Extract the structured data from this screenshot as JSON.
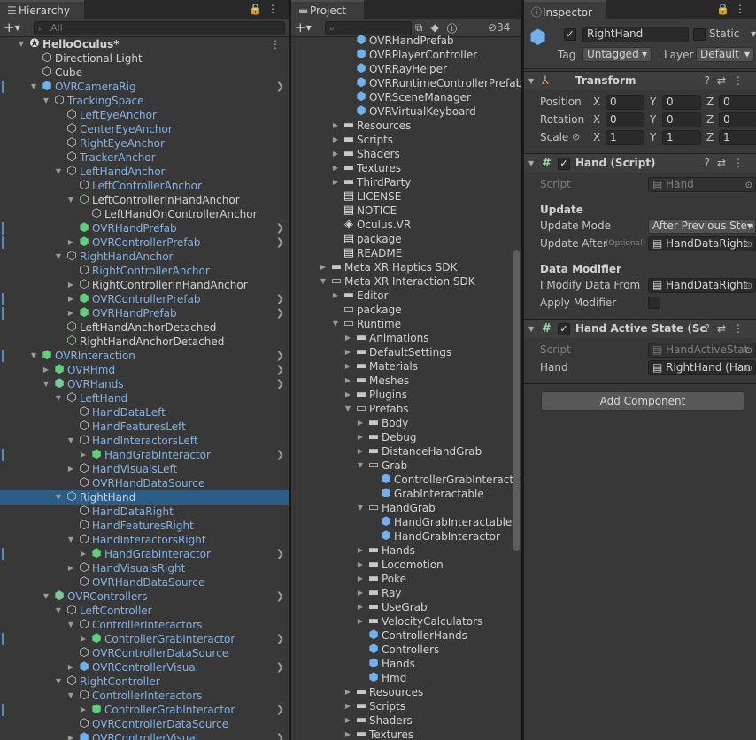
{
  "colors": {
    "selection": "#2c5d87",
    "prefab_blue": "#7ab4ef",
    "panel": "#383838",
    "tabbar": "#282828"
  },
  "hierarchy": {
    "tab_label": "Hierarchy",
    "search_placeholder": "All",
    "items": [
      {
        "label": "HelloOculus*",
        "depth": 0,
        "icon": "unity-scene-icon",
        "expanded": true,
        "bold": true,
        "kebab": true
      },
      {
        "label": "Directional Light",
        "depth": 1,
        "icon": "gameobject-icon"
      },
      {
        "label": "Cube",
        "depth": 1,
        "icon": "gameobject-icon"
      },
      {
        "label": "OVRCameraRig",
        "depth": 1,
        "icon": "prefab-icon",
        "prefab": true,
        "expanded": true,
        "arrow": true,
        "mark": true
      },
      {
        "label": "TrackingSpace",
        "depth": 2,
        "icon": "gameobject-icon",
        "prefab": true,
        "expanded": true
      },
      {
        "label": "LeftEyeAnchor",
        "depth": 3,
        "icon": "gameobject-icon",
        "prefab": true
      },
      {
        "label": "CenterEyeAnchor",
        "depth": 3,
        "icon": "gameobject-icon",
        "prefab": true
      },
      {
        "label": "RightEyeAnchor",
        "depth": 3,
        "icon": "gameobject-icon",
        "prefab": true
      },
      {
        "label": "TrackerAnchor",
        "depth": 3,
        "icon": "gameobject-icon",
        "prefab": true
      },
      {
        "label": "LeftHandAnchor",
        "depth": 3,
        "icon": "gameobject-icon",
        "prefab": true,
        "expanded": true
      },
      {
        "label": "LeftControllerAnchor",
        "depth": 4,
        "icon": "gameobject-icon",
        "prefab": true
      },
      {
        "label": "LeftControllerInHandAnchor",
        "depth": 4,
        "icon": "gameobject-added-icon",
        "expanded": true
      },
      {
        "label": "LeftHandOnControllerAnchor",
        "depth": 5,
        "icon": "gameobject-icon"
      },
      {
        "label": "OVRHandPrefab",
        "depth": 4,
        "icon": "prefab-added-icon",
        "prefab": true,
        "arrow": true,
        "mark": true
      },
      {
        "label": "OVRControllerPrefab",
        "depth": 4,
        "icon": "prefab-added-icon",
        "prefab": true,
        "collapsed": true,
        "arrow": true,
        "mark": true
      },
      {
        "label": "RightHandAnchor",
        "depth": 3,
        "icon": "gameobject-icon",
        "prefab": true,
        "expanded": true
      },
      {
        "label": "RightControllerAnchor",
        "depth": 4,
        "icon": "gameobject-icon",
        "prefab": true
      },
      {
        "label": "RightControllerInHandAnchor",
        "depth": 4,
        "icon": "gameobject-added-icon",
        "collapsed": true
      },
      {
        "label": "OVRControllerPrefab",
        "depth": 4,
        "icon": "prefab-added-icon",
        "prefab": true,
        "collapsed": true,
        "arrow": true,
        "mark": true
      },
      {
        "label": "OVRHandPrefab",
        "depth": 4,
        "icon": "prefab-added-icon",
        "prefab": true,
        "collapsed": true,
        "arrow": true,
        "mark": true
      },
      {
        "label": "LeftHandAnchorDetached",
        "depth": 3,
        "icon": "gameobject-added-icon"
      },
      {
        "label": "RightHandAnchorDetached",
        "depth": 3,
        "icon": "gameobject-added-icon"
      },
      {
        "label": "OVRInteraction",
        "depth": 1,
        "icon": "prefab-added-icon",
        "prefab": true,
        "expanded": true,
        "arrow": true,
        "mark": true
      },
      {
        "label": "OVRHmd",
        "depth": 2,
        "icon": "prefab-added-icon",
        "prefab": true,
        "collapsed": true,
        "arrow": true
      },
      {
        "label": "OVRHands",
        "depth": 2,
        "icon": "prefab-variant-icon",
        "prefab": true,
        "expanded": true,
        "arrow": true
      },
      {
        "label": "LeftHand",
        "depth": 3,
        "icon": "gameobject-icon",
        "prefab": true,
        "expanded": true
      },
      {
        "label": "HandDataLeft",
        "depth": 4,
        "icon": "gameobject-icon",
        "prefab": true
      },
      {
        "label": "HandFeaturesLeft",
        "depth": 4,
        "icon": "gameobject-icon",
        "prefab": true
      },
      {
        "label": "HandInteractorsLeft",
        "depth": 4,
        "icon": "gameobject-icon",
        "prefab": true,
        "expanded": true
      },
      {
        "label": "HandGrabInteractor",
        "depth": 5,
        "icon": "prefab-added-icon",
        "prefab": true,
        "collapsed": true,
        "arrow": true,
        "mark": true
      },
      {
        "label": "HandVisualsLeft",
        "depth": 4,
        "icon": "gameobject-icon",
        "prefab": true,
        "collapsed": true
      },
      {
        "label": "OVRHandDataSource",
        "depth": 4,
        "icon": "gameobject-icon",
        "prefab": true
      },
      {
        "label": "RightHand",
        "depth": 3,
        "icon": "gameobject-icon",
        "expanded": true,
        "selected": true
      },
      {
        "label": "HandDataRight",
        "depth": 4,
        "icon": "gameobject-icon",
        "prefab": true
      },
      {
        "label": "HandFeaturesRight",
        "depth": 4,
        "icon": "gameobject-icon",
        "prefab": true
      },
      {
        "label": "HandInteractorsRight",
        "depth": 4,
        "icon": "gameobject-icon",
        "prefab": true,
        "expanded": true
      },
      {
        "label": "HandGrabInteractor",
        "depth": 5,
        "icon": "prefab-added-icon",
        "prefab": true,
        "collapsed": true,
        "arrow": true,
        "mark": true
      },
      {
        "label": "HandVisualsRight",
        "depth": 4,
        "icon": "gameobject-icon",
        "prefab": true,
        "collapsed": true
      },
      {
        "label": "OVRHandDataSource",
        "depth": 4,
        "icon": "gameobject-icon",
        "prefab": true
      },
      {
        "label": "OVRControllers",
        "depth": 2,
        "icon": "prefab-variant-icon",
        "prefab": true,
        "expanded": true,
        "arrow": true
      },
      {
        "label": "LeftController",
        "depth": 3,
        "icon": "gameobject-icon",
        "prefab": true,
        "expanded": true
      },
      {
        "label": "ControllerInteractors",
        "depth": 4,
        "icon": "gameobject-icon",
        "prefab": true,
        "expanded": true
      },
      {
        "label": "ControllerGrabInteractor",
        "depth": 5,
        "icon": "prefab-added-icon",
        "prefab": true,
        "collapsed": true,
        "arrow": true,
        "mark": true
      },
      {
        "label": "OVRControllerDataSource",
        "depth": 4,
        "icon": "gameobject-icon",
        "prefab": true
      },
      {
        "label": "OVRControllerVisual",
        "depth": 4,
        "icon": "prefab-icon",
        "prefab": true,
        "collapsed": true,
        "arrow": true
      },
      {
        "label": "RightController",
        "depth": 3,
        "icon": "gameobject-icon",
        "prefab": true,
        "expanded": true
      },
      {
        "label": "ControllerInteractors",
        "depth": 4,
        "icon": "gameobject-icon",
        "prefab": true,
        "expanded": true
      },
      {
        "label": "ControllerGrabInteractor",
        "depth": 5,
        "icon": "prefab-added-icon",
        "prefab": true,
        "collapsed": true,
        "arrow": true,
        "mark": true
      },
      {
        "label": "OVRControllerDataSource",
        "depth": 4,
        "icon": "gameobject-icon",
        "prefab": true
      },
      {
        "label": "OVRControllerVisual",
        "depth": 4,
        "icon": "prefab-icon",
        "prefab": true,
        "collapsed": true,
        "arrow": true
      }
    ]
  },
  "project": {
    "tab_label": "Project",
    "hidden_count": "34",
    "items": [
      {
        "label": "OVRHandPrefab",
        "depth": 3,
        "icon": "prefab-icon"
      },
      {
        "label": "OVRPlayerController",
        "depth": 3,
        "icon": "prefab-icon"
      },
      {
        "label": "OVRRayHelper",
        "depth": 3,
        "icon": "prefab-icon"
      },
      {
        "label": "OVRRuntimeControllerPrefab",
        "depth": 3,
        "icon": "prefab-icon"
      },
      {
        "label": "OVRSceneManager",
        "depth": 3,
        "icon": "prefab-icon"
      },
      {
        "label": "OVRVirtualKeyboard",
        "depth": 3,
        "icon": "prefab-icon"
      },
      {
        "label": "Resources",
        "depth": 2,
        "icon": "folder-icon",
        "collapsed": true
      },
      {
        "label": "Scripts",
        "depth": 2,
        "icon": "folder-icon",
        "collapsed": true
      },
      {
        "label": "Shaders",
        "depth": 2,
        "icon": "folder-icon",
        "collapsed": true
      },
      {
        "label": "Textures",
        "depth": 2,
        "icon": "folder-icon",
        "collapsed": true
      },
      {
        "label": "ThirdParty",
        "depth": 2,
        "icon": "folder-icon",
        "collapsed": true
      },
      {
        "label": "LICENSE",
        "depth": 2,
        "icon": "text-file-icon"
      },
      {
        "label": "NOTICE",
        "depth": 2,
        "icon": "text-file-icon"
      },
      {
        "label": "Oculus.VR",
        "depth": 2,
        "icon": "assembly-icon"
      },
      {
        "label": "package",
        "depth": 2,
        "icon": "text-file-icon"
      },
      {
        "label": "README",
        "depth": 2,
        "icon": "text-file-icon"
      },
      {
        "label": "Meta XR Haptics SDK",
        "depth": 1,
        "icon": "folder-icon",
        "collapsed": true
      },
      {
        "label": "Meta XR Interaction SDK",
        "depth": 1,
        "icon": "folder-open-icon",
        "expanded": true
      },
      {
        "label": "Editor",
        "depth": 2,
        "icon": "folder-icon",
        "collapsed": true
      },
      {
        "label": "package",
        "depth": 2,
        "icon": "folder-empty-icon"
      },
      {
        "label": "Runtime",
        "depth": 2,
        "icon": "folder-open-icon",
        "expanded": true
      },
      {
        "label": "Animations",
        "depth": 3,
        "icon": "folder-icon",
        "collapsed": true
      },
      {
        "label": "DefaultSettings",
        "depth": 3,
        "icon": "folder-icon",
        "collapsed": true
      },
      {
        "label": "Materials",
        "depth": 3,
        "icon": "folder-icon",
        "collapsed": true
      },
      {
        "label": "Meshes",
        "depth": 3,
        "icon": "folder-icon",
        "collapsed": true
      },
      {
        "label": "Plugins",
        "depth": 3,
        "icon": "folder-icon",
        "collapsed": true
      },
      {
        "label": "Prefabs",
        "depth": 3,
        "icon": "folder-open-icon",
        "expanded": true
      },
      {
        "label": "Body",
        "depth": 4,
        "icon": "folder-icon",
        "collapsed": true
      },
      {
        "label": "Debug",
        "depth": 4,
        "icon": "folder-icon",
        "collapsed": true
      },
      {
        "label": "DistanceHandGrab",
        "depth": 4,
        "icon": "folder-icon",
        "collapsed": true
      },
      {
        "label": "Grab",
        "depth": 4,
        "icon": "folder-open-icon",
        "expanded": true
      },
      {
        "label": "ControllerGrabInteractor",
        "depth": 5,
        "icon": "prefab-icon"
      },
      {
        "label": "GrabInteractable",
        "depth": 5,
        "icon": "prefab-icon"
      },
      {
        "label": "HandGrab",
        "depth": 4,
        "icon": "folder-open-icon",
        "expanded": true
      },
      {
        "label": "HandGrabInteractable",
        "depth": 5,
        "icon": "prefab-icon"
      },
      {
        "label": "HandGrabInteractor",
        "depth": 5,
        "icon": "prefab-icon"
      },
      {
        "label": "Hands",
        "depth": 4,
        "icon": "folder-icon",
        "collapsed": true
      },
      {
        "label": "Locomotion",
        "depth": 4,
        "icon": "folder-icon",
        "collapsed": true
      },
      {
        "label": "Poke",
        "depth": 4,
        "icon": "folder-icon",
        "collapsed": true
      },
      {
        "label": "Ray",
        "depth": 4,
        "icon": "folder-icon",
        "collapsed": true
      },
      {
        "label": "UseGrab",
        "depth": 4,
        "icon": "folder-icon",
        "collapsed": true
      },
      {
        "label": "VelocityCalculators",
        "depth": 4,
        "icon": "folder-icon",
        "collapsed": true
      },
      {
        "label": "ControllerHands",
        "depth": 4,
        "icon": "prefab-icon"
      },
      {
        "label": "Controllers",
        "depth": 4,
        "icon": "prefab-icon"
      },
      {
        "label": "Hands",
        "depth": 4,
        "icon": "prefab-icon"
      },
      {
        "label": "Hmd",
        "depth": 4,
        "icon": "prefab-icon"
      },
      {
        "label": "Resources",
        "depth": 3,
        "icon": "folder-icon",
        "collapsed": true
      },
      {
        "label": "Scripts",
        "depth": 3,
        "icon": "folder-icon",
        "collapsed": true
      },
      {
        "label": "Shaders",
        "depth": 3,
        "icon": "folder-icon",
        "collapsed": true
      },
      {
        "label": "Textures",
        "depth": 3,
        "icon": "folder-icon",
        "collapsed": true
      }
    ]
  },
  "inspector": {
    "tab_label": "Inspector",
    "object_name": "RightHand",
    "static_label": "Static",
    "tag_label": "Tag",
    "tag_value": "Untagged",
    "layer_label": "Layer",
    "layer_value": "Default",
    "transform": {
      "title": "Transform",
      "position_label": "Position",
      "rotation_label": "Rotation",
      "scale_label": "Scale",
      "axes": [
        "X",
        "Y",
        "Z"
      ],
      "position": [
        "0",
        "0",
        "0"
      ],
      "rotation": [
        "0",
        "0",
        "0"
      ],
      "scale": [
        "1",
        "1",
        "1"
      ]
    },
    "hand_script": {
      "title": "Hand (Script)",
      "script_label": "Script",
      "script_value": "Hand",
      "update_section": "Update",
      "update_mode_label": "Update Mode",
      "update_mode_value": "After Previous Step",
      "update_after_label": "Update After",
      "update_after_hint": "(Optional)",
      "update_after_value": "HandDataRight",
      "data_modifier_section": "Data Modifier",
      "modify_label": "I Modify Data From So",
      "modify_value": "HandDataRight",
      "apply_modifier_label": "Apply Modifier"
    },
    "hand_active_state": {
      "title": "Hand Active State (Scrip",
      "script_label": "Script",
      "script_value": "HandActiveStat",
      "hand_label": "Hand",
      "hand_value": "RightHand (Han"
    },
    "add_component_label": "Add Component"
  }
}
